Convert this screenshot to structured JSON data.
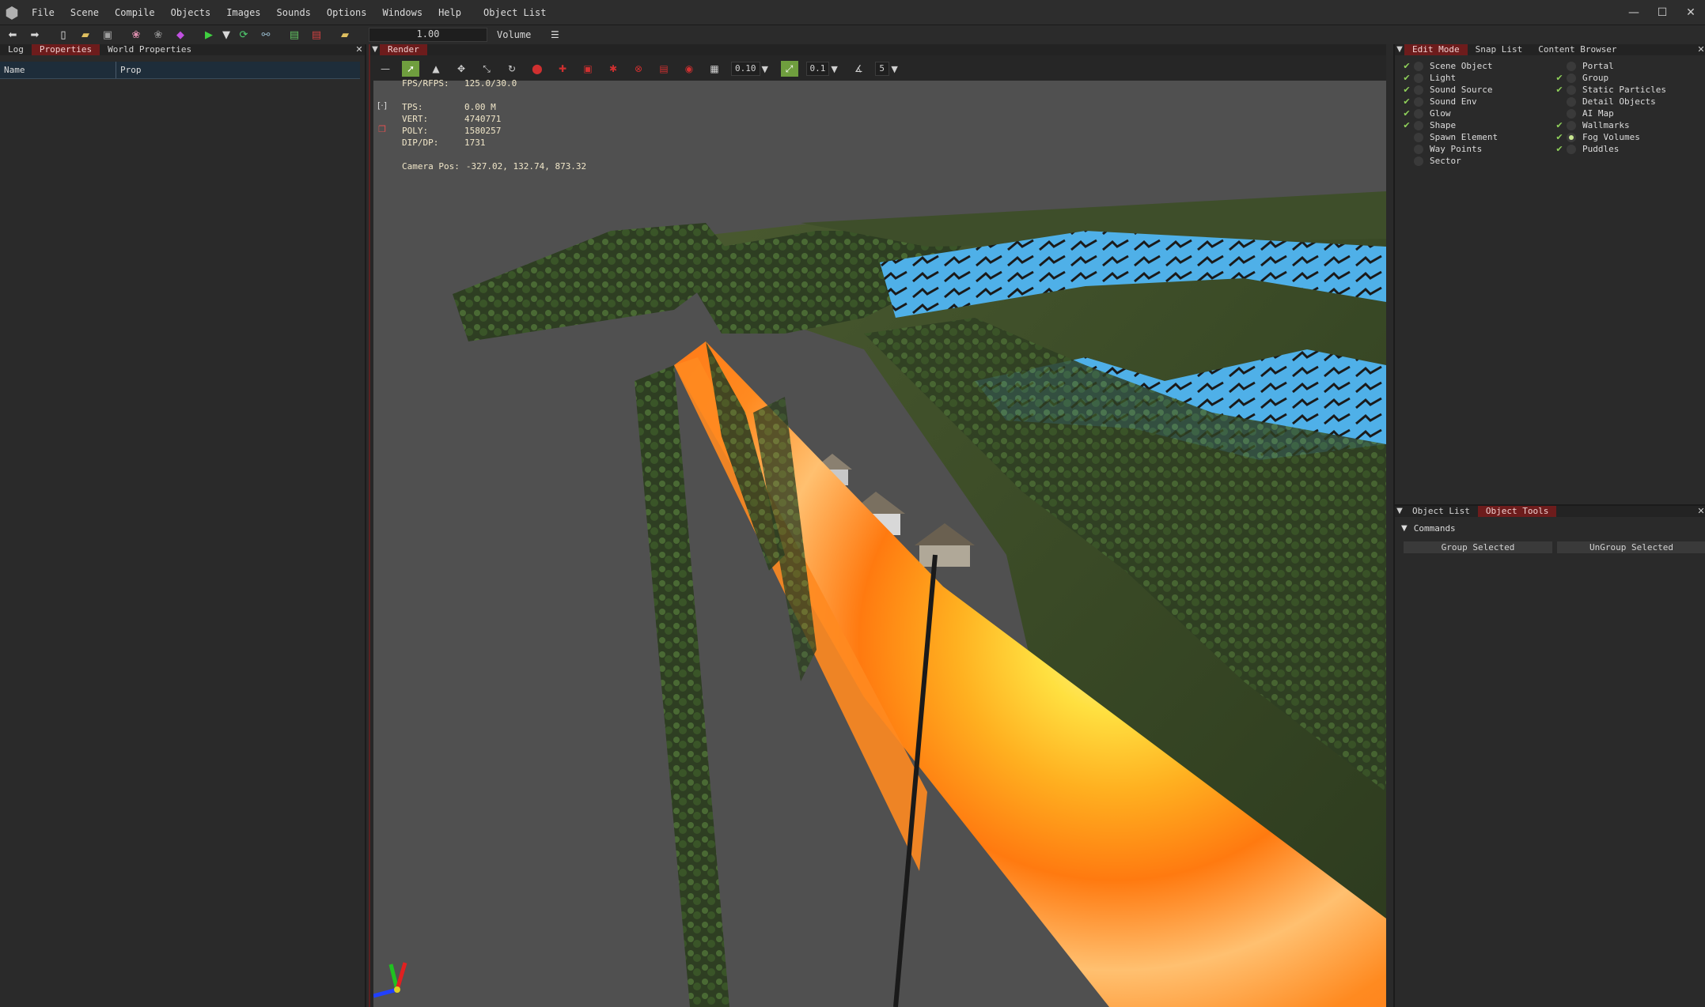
{
  "menu": {
    "items": [
      "File",
      "Scene",
      "Compile",
      "Objects",
      "Images",
      "Sounds",
      "Options",
      "Windows",
      "Help"
    ],
    "object_list": "Object List"
  },
  "window_controls": {
    "minimize": "—",
    "maximize": "☐",
    "close": "✕"
  },
  "toolbar": {
    "speed_value": "1.00",
    "volume_label": "Volume"
  },
  "left_panel": {
    "tabs": [
      "Log",
      "Properties",
      "World Properties"
    ],
    "active_tab": "Properties",
    "columns": {
      "name": "Name",
      "prop": "Prop"
    }
  },
  "render": {
    "tab_label": "Render",
    "grid_step": "0.10",
    "snap_step": "0.1",
    "angle_step": "5",
    "stats": {
      "fps_label": "FPS/RFPS:",
      "fps_value": "125.0/30.0",
      "tps_label": "TPS:",
      "tps_value": "0.00 M",
      "vert_label": "VERT:",
      "vert_value": "4740771",
      "poly_label": "POLY:",
      "poly_value": "1580257",
      "dip_label": "DIP/DP:",
      "dip_value": "1731",
      "camera_label": "Camera Pos:",
      "camera_value": "-327.02, 132.74, 873.32"
    }
  },
  "right_panel": {
    "tabs": [
      "Edit Mode",
      "Snap List",
      "Content Browser"
    ],
    "active_tab": "Edit Mode",
    "flags_left": [
      {
        "label": "Scene Object",
        "checked": true,
        "dot": false
      },
      {
        "label": "Light",
        "checked": true,
        "dot": false
      },
      {
        "label": "Sound Source",
        "checked": true,
        "dot": false
      },
      {
        "label": "Sound Env",
        "checked": true,
        "dot": false
      },
      {
        "label": "Glow",
        "checked": true,
        "dot": false
      },
      {
        "label": "Shape",
        "checked": true,
        "dot": false
      },
      {
        "label": "Spawn Element",
        "checked": false,
        "dot": false
      },
      {
        "label": "Way Points",
        "checked": false,
        "dot": false
      },
      {
        "label": "Sector",
        "checked": false,
        "dot": false
      }
    ],
    "flags_right": [
      {
        "label": "Portal",
        "checked": false,
        "dot": false
      },
      {
        "label": "Group",
        "checked": true,
        "dot": false
      },
      {
        "label": "Static Particles",
        "checked": true,
        "dot": false
      },
      {
        "label": "Detail Objects",
        "checked": false,
        "dot": false
      },
      {
        "label": "AI Map",
        "checked": false,
        "dot": false
      },
      {
        "label": "Wallmarks",
        "checked": true,
        "dot": false
      },
      {
        "label": "Fog Volumes",
        "checked": true,
        "dot": true
      },
      {
        "label": "Puddles",
        "checked": true,
        "dot": false
      }
    ],
    "bottom_tabs": [
      "Object List",
      "Object Tools"
    ],
    "bottom_active_tab": "Object Tools",
    "commands_label": "Commands",
    "group_selected": "Group Selected",
    "ungroup_selected": "UnGroup Selected"
  },
  "colors": {
    "active_tab": "#6d1c1c",
    "accent_green": "#6f9e3e",
    "checkmark": "#8fd05a"
  }
}
